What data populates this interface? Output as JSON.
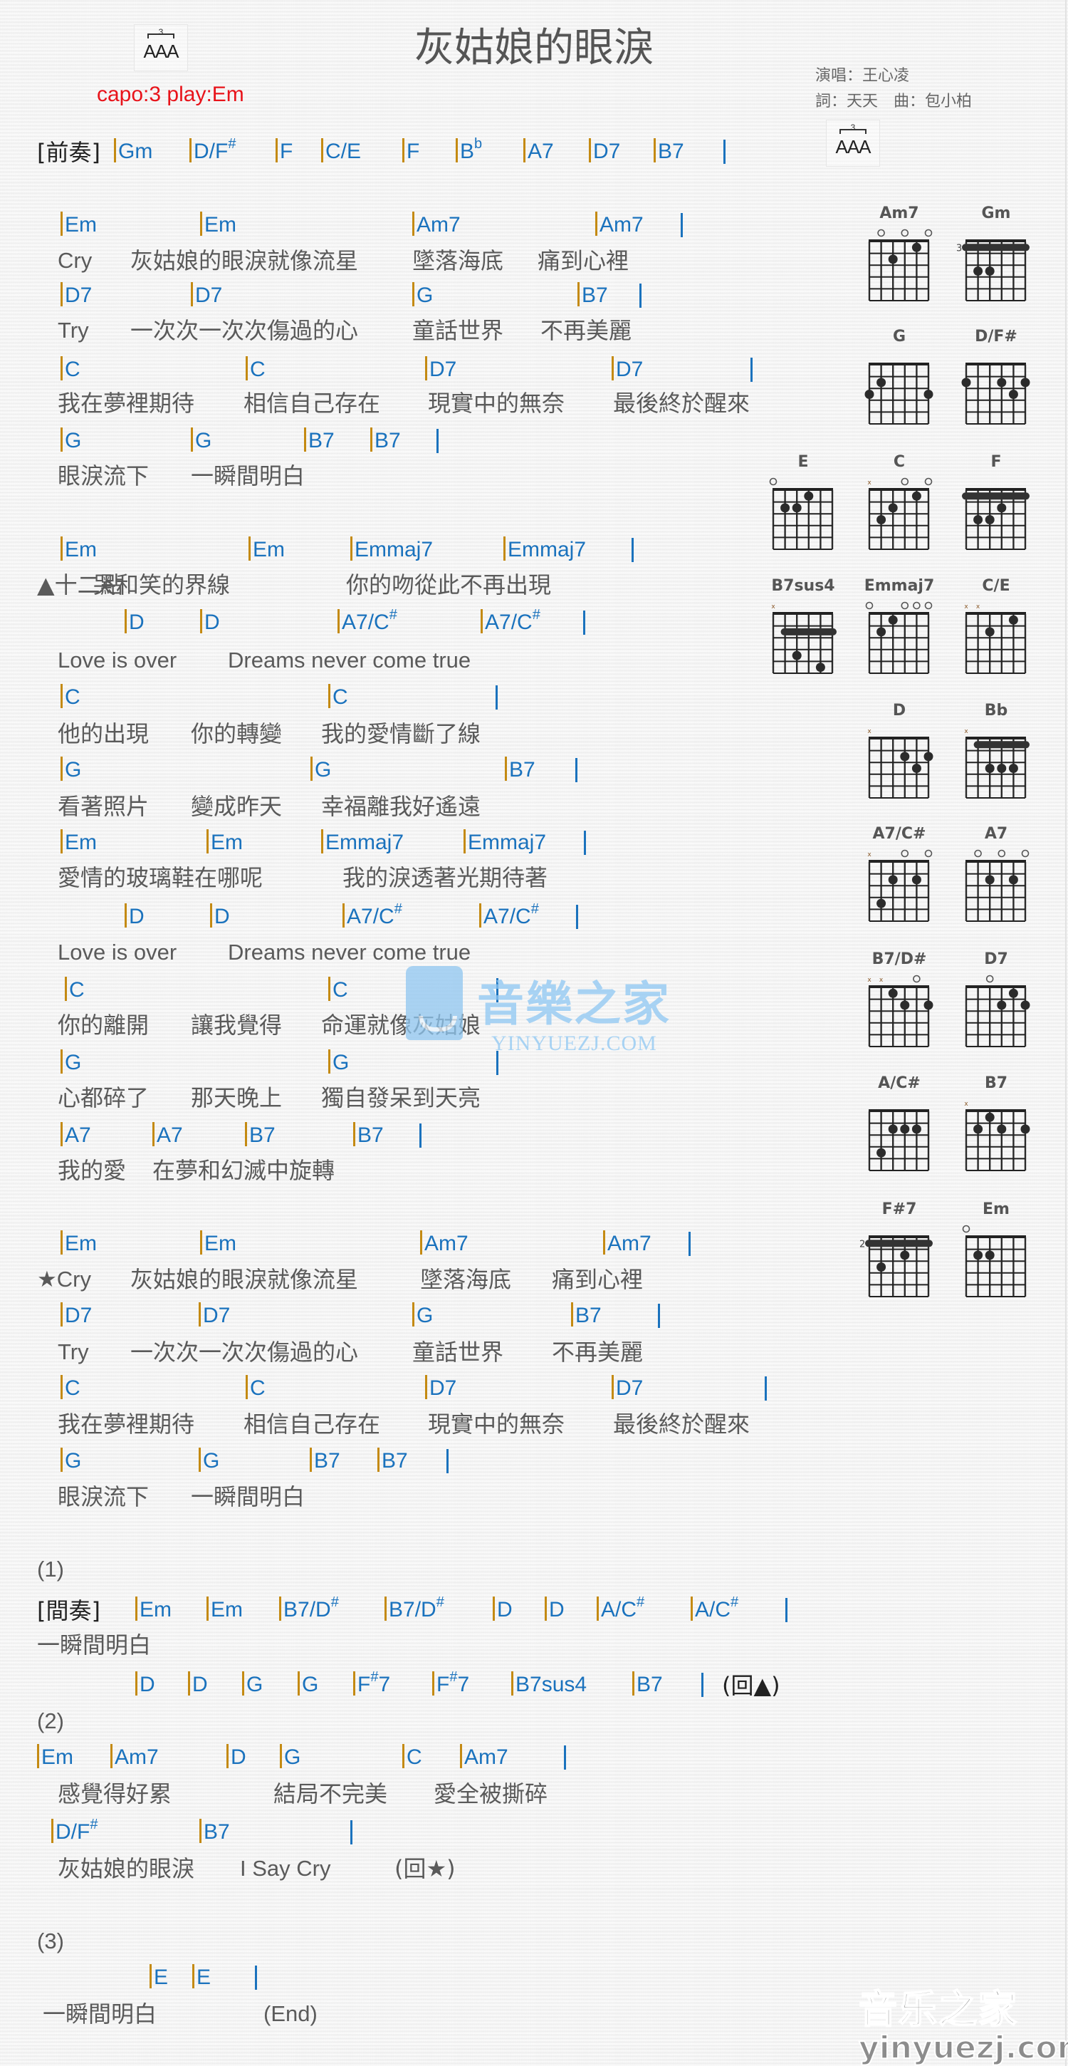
{
  "header": {
    "title": "灰姑娘的眼淚",
    "capo": "capo:3 play:Em",
    "singer": "演唱：王心凌",
    "writers": "詞：天天　曲：包小柏",
    "rhythm": {
      "triplet": "3",
      "pattern": "AAA"
    }
  },
  "colors": {
    "chord": "#1a72bd",
    "bar": "#c48a12",
    "capo": "#e8131a",
    "lyric": "#5a5a5a"
  },
  "sheet": [
    {
      "kind": "chord",
      "segs": [
        {
          "t": "[前奏]",
          "label": true
        },
        {
          "c": "Gm"
        },
        {
          "c": "D/F",
          "sup": "#"
        },
        {
          "c": "F"
        },
        {
          "c": "C/E"
        },
        {
          "c": "F"
        },
        {
          "c": "B",
          "sup": "b"
        },
        {
          "c": "A7"
        },
        {
          "c": "D7"
        },
        {
          "c": "B7"
        }
      ],
      "end": true
    },
    {
      "kind": "chord",
      "segs": [
        {
          "c": "Em"
        },
        {
          "c": "Em"
        },
        {
          "c": "Am7"
        },
        {
          "c": "Am7"
        }
      ],
      "end": true
    },
    {
      "kind": "lyric",
      "segs": [
        {
          "t": "Cry",
          "en": true
        },
        {
          "t": "灰姑娘的眼淚就像流星"
        },
        {
          "t": "墜落海底"
        },
        {
          "t": "痛到心裡"
        }
      ]
    },
    {
      "kind": "chord",
      "segs": [
        {
          "c": "D7"
        },
        {
          "c": "D7"
        },
        {
          "c": "G"
        },
        {
          "c": "B7"
        }
      ],
      "end": true
    },
    {
      "kind": "lyric",
      "segs": [
        {
          "t": "Try",
          "en": true
        },
        {
          "t": "一次次一次次傷過的心"
        },
        {
          "t": "童話世界"
        },
        {
          "t": "不再美麗"
        }
      ]
    },
    {
      "kind": "chord",
      "segs": [
        {
          "c": "C"
        },
        {
          "c": "C"
        },
        {
          "c": "D7"
        },
        {
          "c": "D7"
        }
      ],
      "end": true
    },
    {
      "kind": "lyric",
      "segs": [
        {
          "t": "我在夢裡期待"
        },
        {
          "t": "相信自己存在"
        },
        {
          "t": "現實中的無奈"
        },
        {
          "t": "最後終於醒來"
        }
      ]
    },
    {
      "kind": "chord",
      "segs": [
        {
          "c": "G"
        },
        {
          "c": "G"
        },
        {
          "c": "B7"
        },
        {
          "c": "B7"
        }
      ],
      "end": true
    },
    {
      "kind": "lyric",
      "segs": [
        {
          "t": "眼淚流下"
        },
        {
          "t": "一瞬間明白"
        }
      ]
    },
    {
      "kind": "chord",
      "segs": [
        {
          "c": "Em"
        },
        {
          "c": "Em"
        },
        {
          "c": "Emmaj7"
        },
        {
          "c": "Emmaj7"
        }
      ],
      "end": true
    },
    {
      "kind": "lyric",
      "segs": [
        {
          "t": "▲十二點"
        },
        {
          "t": "哭和笑的界線"
        },
        {
          "t": "你的吻從此不再出現"
        }
      ]
    },
    {
      "kind": "chord",
      "segs": [
        {
          "c": "D"
        },
        {
          "c": "D"
        },
        {
          "c": "A7/C",
          "sup": "#"
        },
        {
          "c": "A7/C",
          "sup": "#"
        }
      ],
      "end": true
    },
    {
      "kind": "lyric",
      "segs": [
        {
          "t": "Love is over",
          "en": true
        },
        {
          "t": "Dreams never come true",
          "en": true
        }
      ]
    },
    {
      "kind": "chord",
      "segs": [
        {
          "c": "C"
        },
        {
          "c": "C"
        }
      ],
      "end": true
    },
    {
      "kind": "lyric",
      "segs": [
        {
          "t": "他的出現"
        },
        {
          "t": "你的轉變"
        },
        {
          "t": "我的愛情斷了線"
        }
      ]
    },
    {
      "kind": "chord",
      "segs": [
        {
          "c": "G"
        },
        {
          "c": "G"
        },
        {
          "c": "B7"
        }
      ],
      "end": true
    },
    {
      "kind": "lyric",
      "segs": [
        {
          "t": "看著照片"
        },
        {
          "t": "變成昨天"
        },
        {
          "t": "幸福離我好遙遠"
        }
      ]
    },
    {
      "kind": "chord",
      "segs": [
        {
          "c": "Em"
        },
        {
          "c": "Em"
        },
        {
          "c": "Emmaj7"
        },
        {
          "c": "Emmaj7"
        }
      ],
      "end": true
    },
    {
      "kind": "lyric",
      "segs": [
        {
          "t": "愛情的玻璃鞋在哪呢"
        },
        {
          "t": "我的淚透著光期待著"
        }
      ]
    },
    {
      "kind": "chord",
      "segs": [
        {
          "c": "D"
        },
        {
          "c": "D"
        },
        {
          "c": "A7/C",
          "sup": "#"
        },
        {
          "c": "A7/C",
          "sup": "#"
        }
      ],
      "end": true
    },
    {
      "kind": "lyric",
      "segs": [
        {
          "t": "Love is over",
          "en": true
        },
        {
          "t": "Dreams never come true",
          "en": true
        }
      ]
    },
    {
      "kind": "chord",
      "segs": [
        {
          "c": "C"
        },
        {
          "c": "C"
        }
      ],
      "end": true
    },
    {
      "kind": "lyric",
      "segs": [
        {
          "t": "你的離開"
        },
        {
          "t": "讓我覺得"
        },
        {
          "t": "命運就像灰姑娘"
        }
      ]
    },
    {
      "kind": "chord",
      "segs": [
        {
          "c": "G"
        },
        {
          "c": "G"
        }
      ],
      "end": true
    },
    {
      "kind": "lyric",
      "segs": [
        {
          "t": "心都碎了"
        },
        {
          "t": "那天晚上"
        },
        {
          "t": "獨自發呆到天亮"
        }
      ]
    },
    {
      "kind": "chord",
      "segs": [
        {
          "c": "A7"
        },
        {
          "c": "A7"
        },
        {
          "c": "B7"
        },
        {
          "c": "B7"
        }
      ],
      "end": true
    },
    {
      "kind": "lyric",
      "segs": [
        {
          "t": "我的愛"
        },
        {
          "t": "在夢和幻滅中旋轉"
        }
      ]
    },
    {
      "kind": "chord",
      "segs": [
        {
          "c": "Em"
        },
        {
          "c": "Em"
        },
        {
          "c": "Am7"
        },
        {
          "c": "Am7"
        }
      ],
      "end": true
    },
    {
      "kind": "lyric",
      "segs": [
        {
          "t": "★Cry",
          "en": true
        },
        {
          "t": "灰姑娘的眼淚就像流星"
        },
        {
          "t": "墜落海底"
        },
        {
          "t": "痛到心裡"
        }
      ]
    },
    {
      "kind": "chord",
      "segs": [
        {
          "c": "D7"
        },
        {
          "c": "D7"
        },
        {
          "c": "G"
        },
        {
          "c": "B7"
        }
      ],
      "end": true
    },
    {
      "kind": "lyric",
      "segs": [
        {
          "t": "Try",
          "en": true
        },
        {
          "t": "一次次一次次傷過的心"
        },
        {
          "t": "童話世界"
        },
        {
          "t": "不再美麗"
        }
      ]
    },
    {
      "kind": "chord",
      "segs": [
        {
          "c": "C"
        },
        {
          "c": "C"
        },
        {
          "c": "D7"
        },
        {
          "c": "D7"
        }
      ],
      "end": true
    },
    {
      "kind": "lyric",
      "segs": [
        {
          "t": "我在夢裡期待"
        },
        {
          "t": "相信自己存在"
        },
        {
          "t": "現實中的無奈"
        },
        {
          "t": "最後終於醒來"
        }
      ]
    },
    {
      "kind": "chord",
      "segs": [
        {
          "c": "G"
        },
        {
          "c": "G"
        },
        {
          "c": "B7"
        },
        {
          "c": "B7"
        }
      ],
      "end": true
    },
    {
      "kind": "lyric",
      "segs": [
        {
          "t": "眼淚流下"
        },
        {
          "t": "一瞬間明白"
        }
      ]
    },
    {
      "kind": "lyric",
      "segs": [
        {
          "t": "(1)",
          "en": true
        }
      ]
    },
    {
      "kind": "chord",
      "segs": [
        {
          "t": "[間奏]",
          "label": true
        },
        {
          "c": "Em"
        },
        {
          "c": "Em"
        },
        {
          "c": "B7/D",
          "sup": "#"
        },
        {
          "c": "B7/D",
          "sup": "#"
        },
        {
          "c": "D"
        },
        {
          "c": "D"
        },
        {
          "c": "A/C",
          "sup": "#"
        },
        {
          "c": "A/C",
          "sup": "#"
        }
      ],
      "end": true
    },
    {
      "kind": "lyric",
      "segs": [
        {
          "t": "一瞬間明白"
        }
      ]
    },
    {
      "kind": "chord",
      "segs": [
        {
          "c": "D"
        },
        {
          "c": "D"
        },
        {
          "c": "G"
        },
        {
          "c": "G"
        },
        {
          "c": "F",
          "sup": "#",
          "post": "7"
        },
        {
          "c": "F",
          "sup": "#",
          "post": "7"
        },
        {
          "c": "B7sus4"
        },
        {
          "c": "B7"
        },
        {
          "t": "(回▲)",
          "label": true
        }
      ],
      "end": true
    },
    {
      "kind": "lyric",
      "segs": [
        {
          "t": "(2)",
          "en": true
        }
      ]
    },
    {
      "kind": "chord",
      "segs": [
        {
          "c": "Em"
        },
        {
          "c": "Am7"
        },
        {
          "c": "D"
        },
        {
          "c": "G"
        },
        {
          "c": "C"
        },
        {
          "c": "Am7"
        }
      ],
      "end": true
    },
    {
      "kind": "lyric",
      "segs": [
        {
          "t": "感覺得好累"
        },
        {
          "t": "結局不完美"
        },
        {
          "t": "愛全被撕碎"
        }
      ]
    },
    {
      "kind": "chord",
      "segs": [
        {
          "c": "D/F",
          "sup": "#"
        },
        {
          "c": "B7"
        }
      ],
      "end": true
    },
    {
      "kind": "lyric",
      "segs": [
        {
          "t": "灰姑娘的眼淚"
        },
        {
          "t": "I Say Cry",
          "en": true
        },
        {
          "t": "(回★)"
        }
      ]
    },
    {
      "kind": "lyric",
      "segs": [
        {
          "t": "(3)",
          "en": true
        }
      ]
    },
    {
      "kind": "chord",
      "segs": [
        {
          "c": "E"
        },
        {
          "c": "E"
        }
      ],
      "end": true
    },
    {
      "kind": "lyric",
      "segs": [
        {
          "t": "一瞬間明白"
        },
        {
          "t": "(End)",
          "en": true
        }
      ]
    }
  ],
  "chord_diagrams": [
    {
      "name": "Am7",
      "open": [
        null,
        "x0",
        null,
        "o",
        null,
        "o",
        "o"
      ],
      "marks": {
        "open": [
          1,
          3,
          5
        ],
        "mute": []
      },
      "dots": [
        [
          2,
          1
        ],
        [
          4,
          0
        ]
      ],
      "barre": null,
      "fret_label": ""
    },
    {
      "name": "Gm",
      "marks": {
        "open": [],
        "mute": []
      },
      "dots": [
        [
          1,
          2
        ],
        [
          2,
          2
        ]
      ],
      "barre": {
        "fret": 0,
        "from": 0,
        "to": 5
      },
      "fret_label": "3"
    },
    {
      "name": "G",
      "marks": {
        "open": [],
        "mute": []
      },
      "dots": [
        [
          1,
          1
        ],
        [
          0,
          2
        ],
        [
          5,
          2
        ]
      ],
      "barre": null,
      "fret_label": ""
    },
    {
      "name": "D/F#",
      "marks": {
        "open": [],
        "mute": []
      },
      "dots": [
        [
          0,
          1
        ],
        [
          3,
          1
        ],
        [
          5,
          1
        ],
        [
          4,
          2
        ]
      ],
      "barre": null,
      "fret_label": ""
    },
    {
      "name": "E",
      "marks": {
        "open": [
          0
        ],
        "mute": []
      },
      "dots": [
        [
          3,
          0
        ],
        [
          1,
          1
        ],
        [
          2,
          1
        ]
      ],
      "barre": null,
      "fret_label": ""
    },
    {
      "name": "C",
      "marks": {
        "open": [
          3,
          5
        ],
        "mute": [
          0
        ]
      },
      "dots": [
        [
          4,
          0
        ],
        [
          2,
          1
        ],
        [
          1,
          2
        ]
      ],
      "barre": null,
      "fret_label": ""
    },
    {
      "name": "F",
      "marks": {
        "open": [],
        "mute": []
      },
      "dots": [
        [
          3,
          1
        ],
        [
          1,
          2
        ],
        [
          2,
          2
        ]
      ],
      "barre": {
        "fret": 0,
        "from": 0,
        "to": 5
      },
      "fret_label": ""
    },
    {
      "name": "B7sus4",
      "marks": {
        "open": [],
        "mute": [
          0
        ]
      },
      "dots": [
        [
          2,
          3
        ],
        [
          4,
          4
        ]
      ],
      "barre": {
        "fret": 1,
        "from": 1,
        "to": 5
      },
      "fret_label": ""
    },
    {
      "name": "Emmaj7",
      "marks": {
        "open": [
          0,
          3,
          4,
          5
        ],
        "mute": []
      },
      "dots": [
        [
          2,
          0
        ],
        [
          1,
          1
        ]
      ],
      "barre": null,
      "fret_label": ""
    },
    {
      "name": "C/E",
      "marks": {
        "open": [],
        "mute": [
          0,
          1
        ]
      },
      "dots": [
        [
          4,
          0
        ],
        [
          2,
          1
        ]
      ],
      "barre": null,
      "fret_label": ""
    },
    {
      "name": "D",
      "marks": {
        "open": [],
        "mute": [
          0
        ]
      },
      "dots": [
        [
          3,
          1
        ],
        [
          5,
          1
        ],
        [
          4,
          2
        ]
      ],
      "barre": null,
      "fret_label": ""
    },
    {
      "name": "Bb",
      "marks": {
        "open": [],
        "mute": [
          0
        ]
      },
      "dots": [
        [
          2,
          2
        ],
        [
          3,
          2
        ],
        [
          4,
          2
        ]
      ],
      "barre": {
        "fret": 0,
        "from": 1,
        "to": 5
      },
      "fret_label": ""
    },
    {
      "name": "A7/C#",
      "marks": {
        "open": [
          3,
          5
        ],
        "mute": [
          0
        ]
      },
      "dots": [
        [
          2,
          1
        ],
        [
          4,
          1
        ],
        [
          1,
          3
        ]
      ],
      "barre": null,
      "fret_label": ""
    },
    {
      "name": "A7",
      "marks": {
        "open": [
          1,
          3,
          5
        ],
        "mute": []
      },
      "dots": [
        [
          2,
          1
        ],
        [
          4,
          1
        ]
      ],
      "barre": null,
      "fret_label": ""
    },
    {
      "name": "B7/D#",
      "marks": {
        "open": [
          4
        ],
        "mute": [
          0,
          1
        ]
      },
      "dots": [
        [
          2,
          0
        ],
        [
          3,
          1
        ],
        [
          5,
          1
        ]
      ],
      "barre": null,
      "fret_label": ""
    },
    {
      "name": "D7",
      "marks": {
        "open": [
          2
        ],
        "mute": []
      },
      "dots": [
        [
          4,
          0
        ],
        [
          3,
          1
        ],
        [
          5,
          1
        ]
      ],
      "barre": null,
      "fret_label": ""
    },
    {
      "name": "A/C#",
      "marks": {
        "open": [],
        "mute": []
      },
      "dots": [
        [
          2,
          1
        ],
        [
          3,
          1
        ],
        [
          4,
          1
        ],
        [
          1,
          3
        ]
      ],
      "barre": null,
      "fret_label": ""
    },
    {
      "name": "B7",
      "marks": {
        "open": [],
        "mute": [
          0
        ]
      },
      "dots": [
        [
          2,
          0
        ],
        [
          1,
          1
        ],
        [
          3,
          1
        ],
        [
          5,
          1
        ]
      ],
      "barre": null,
      "fret_label": ""
    },
    {
      "name": "F#7",
      "marks": {
        "open": [],
        "mute": []
      },
      "dots": [
        [
          3,
          1
        ],
        [
          1,
          2
        ]
      ],
      "barre": {
        "fret": 0,
        "from": 0,
        "to": 5
      },
      "fret_label": "2"
    },
    {
      "name": "Em",
      "marks": {
        "open": [
          0
        ],
        "mute": []
      },
      "dots": [
        [
          1,
          1
        ],
        [
          2,
          1
        ]
      ],
      "barre": null,
      "fret_label": ""
    }
  ],
  "watermark": {
    "brand": "音樂之家",
    "domain": "YINYUEZJ.COM",
    "corner_brand": "音乐之家",
    "corner_domain": "yinyuezj.com"
  }
}
